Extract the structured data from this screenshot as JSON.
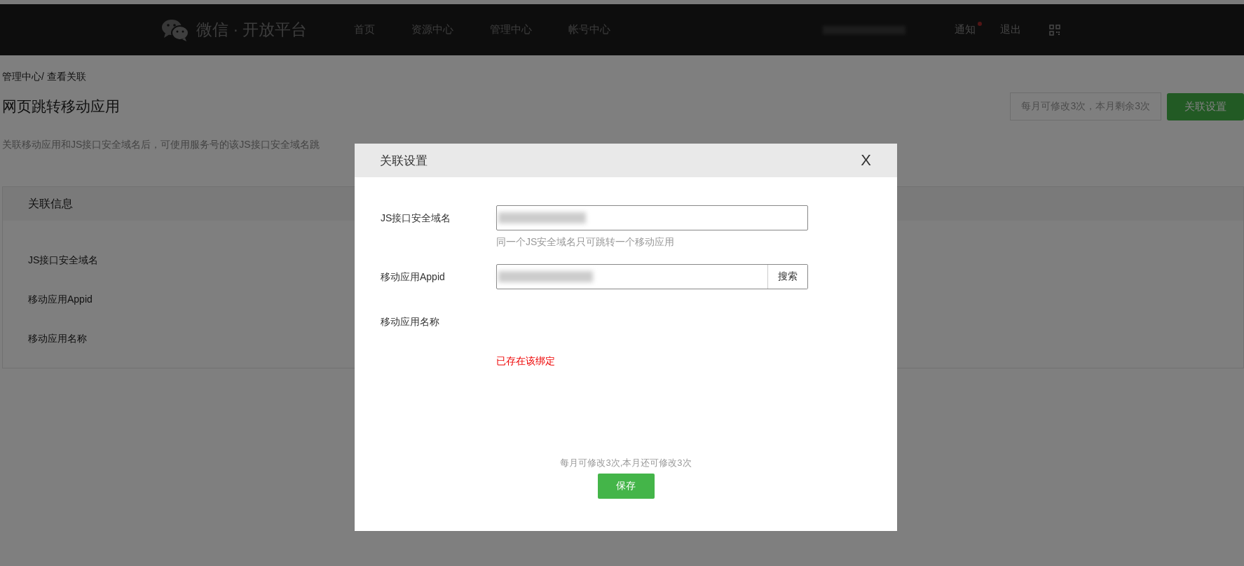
{
  "header": {
    "logo_text": "微信 · 开放平台",
    "nav": [
      "首页",
      "资源中心",
      "管理中心",
      "帐号中心"
    ],
    "notification": {
      "label": "通知",
      "unread": true
    },
    "logout": "退出"
  },
  "breadcrumb": "管理中心/ 查看关联",
  "page_title": "网页跳转移动应用",
  "quota": "每月可修改3次，本月剩余3次",
  "settings_button": "关联设置",
  "description": "关联移动应用和JS接口安全域名后，可使用服务号的该JS接口安全域名跳",
  "panel": {
    "title": "关联信息",
    "fields": [
      "JS接口安全域名",
      "移动应用Appid",
      "移动应用名称"
    ]
  },
  "dialog": {
    "title": "关联设置",
    "close": "X",
    "fields": [
      {
        "kind": "input",
        "label": "JS接口安全域名",
        "hint": "同一个JS安全域名只可跳转一个移动应用"
      },
      {
        "kind": "search",
        "label": "移动应用Appid",
        "button": "搜索"
      },
      {
        "kind": "text",
        "label": "移动应用名称"
      }
    ],
    "error": "已存在该绑定",
    "quota_note": "每月可修改3次,本月还可修改3次",
    "save": "保存"
  }
}
